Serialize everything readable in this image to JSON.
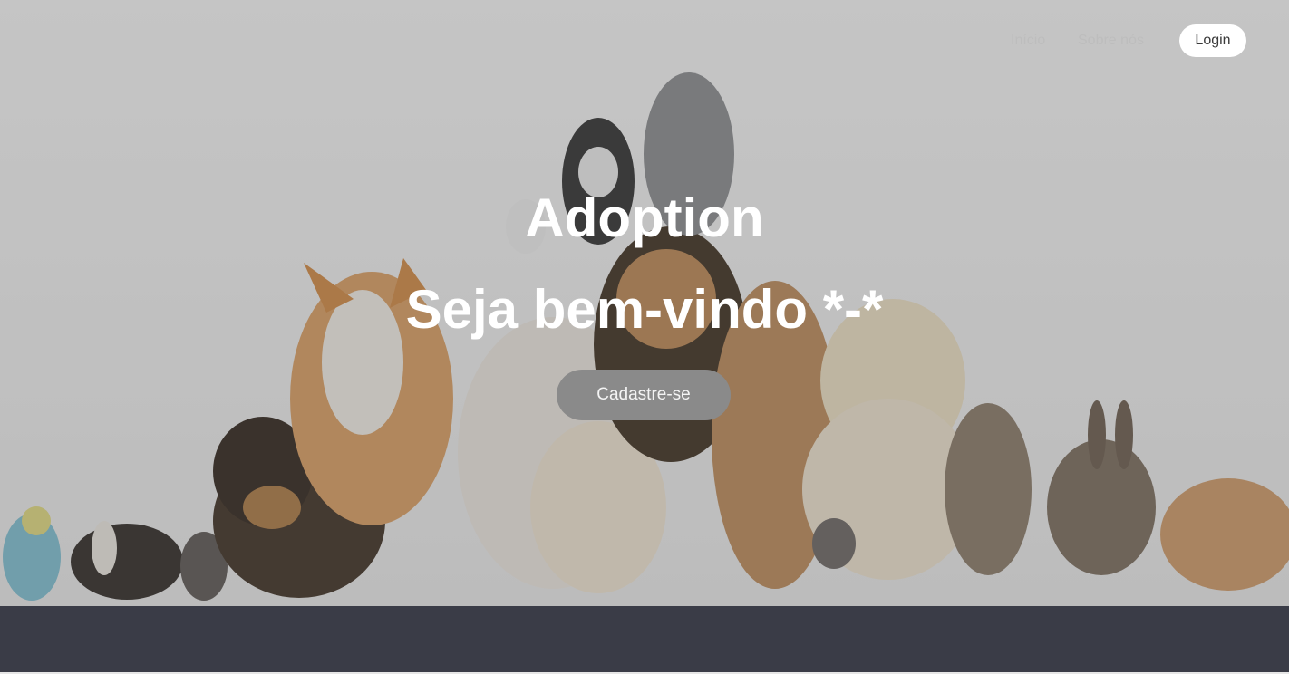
{
  "nav": {
    "links": [
      {
        "label": "Início"
      },
      {
        "label": "Sobre nós"
      }
    ],
    "login_label": "Login"
  },
  "hero": {
    "title": "Adoption",
    "subtitle": "Seja bem-vindo *-*",
    "cta_label": "Cadastre-se",
    "image_subject": "group of pets: dogs, cats, rabbits, guinea pigs, rats and a parakeet"
  },
  "colors": {
    "footer": "#3a3c47",
    "cta": "#8a8a8a",
    "login_bg": "#ffffff"
  }
}
